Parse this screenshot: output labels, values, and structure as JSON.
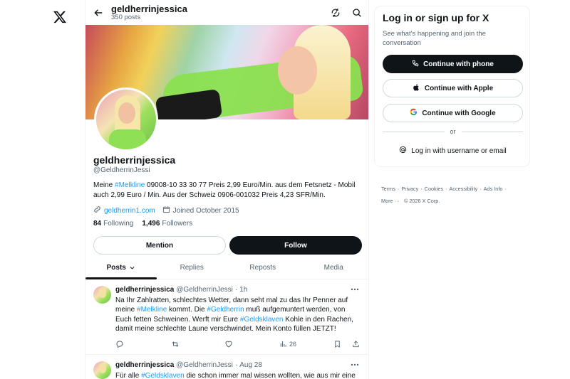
{
  "nav": {
    "logo_icon": "x-logo-icon"
  },
  "header": {
    "name": "geldherrinjessica",
    "posts_count": "350 posts"
  },
  "profile": {
    "display_name": "geldherrinjessica",
    "handle": "@GeldherrinJessi",
    "bio_pre": "Meine ",
    "bio_hashtag": "#Melkline",
    "bio_post": "  09008-10 33 30 77 Preis 2,99 Euro/Min. aus dem Fetsnetz - Mobil auch 2,99 Euro / Min. Aus der Schweiz 0906-001032 Preis 4,23 SFR/Min.",
    "website": "geldherrin1.com",
    "joined": "Joined October 2015",
    "following_count": "84",
    "following_label": "Following",
    "followers_count": "1,496",
    "followers_label": "Followers",
    "mention_label": "Mention",
    "follow_label": "Follow"
  },
  "tabs": [
    "Posts",
    "Replies",
    "Reposts",
    "Media"
  ],
  "posts": [
    {
      "name": "geldherrinjessica",
      "handle": "@GeldherrinJessi",
      "dot": "·",
      "time": "1h",
      "t1": "Na Ihr Zahlratten, schlechtes Wetter, dann seht mal zu das Ihr Penner auf meine ",
      "h1": "#Melkline",
      "t2": " kommt. Die ",
      "h2": "#Geldherrin",
      "t3": " muß aufgemuntert werden, von Euch fetten Schweinen. Werft mir Eure ",
      "h3": "#Geldsklaven",
      "t4": " Kohle in den Rachen, damit meine schlechte Laune verschwindet. Mein Konto füllen JETZT!",
      "views": "26"
    },
    {
      "name": "geldherrinjessica",
      "handle": "@GeldherrinJessi",
      "dot": "·",
      "time": "Aug 28",
      "t1": "Für alle ",
      "h1": "#Geldsklaven",
      "t2": " die schon immer mal wissen wollten, wie aus mir eine"
    }
  ],
  "login": {
    "title": "Log in or sign up for X",
    "subtitle": "See what's happening and join the conversation",
    "phone": "Continue with phone",
    "apple": "Continue with Apple",
    "google": "Continue with Google",
    "or": "or",
    "username": "Log in with username or email"
  },
  "footer": {
    "terms": "Terms",
    "privacy": "Privacy",
    "cookies": "Cookies",
    "accessibility": "Accessibility",
    "ads": "Ads Info",
    "more": "More ···",
    "copyright": "© 2026 X Corp."
  },
  "colors": {
    "accent": "#1d9bf0",
    "text": "#0f1419",
    "muted": "#536471",
    "border": "#eff3f4"
  }
}
